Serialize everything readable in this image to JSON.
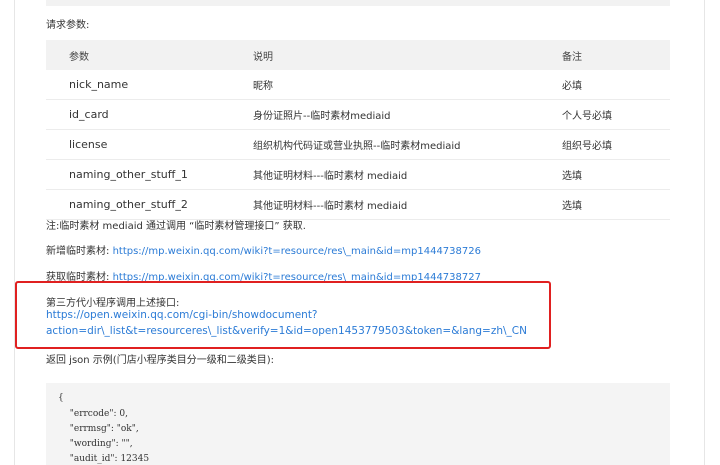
{
  "request_params_label": "请求参数:",
  "table": {
    "headers": [
      "参数",
      "说明",
      "备注"
    ],
    "rows": [
      {
        "param": "nick_name",
        "desc": "昵称",
        "note": "必填"
      },
      {
        "param": "id_card",
        "desc": "身份证照片--临时素材mediaid",
        "note": "个人号必填"
      },
      {
        "param": "license",
        "desc": "组织机构代码证或营业执照--临时素材mediaid",
        "note": "组织号必填"
      },
      {
        "param": "naming_other_stuff_1",
        "desc": "其他证明材料---临时素材 mediaid",
        "note": "选填"
      },
      {
        "param": "naming_other_stuff_2",
        "desc": "其他证明材料---临时素材 mediaid",
        "note": "选填"
      }
    ]
  },
  "note_line": "注:临时素材 mediaid 通过调用 “临时素材管理接口” 获取.",
  "new_material": {
    "label": "新增临时素材: ",
    "url": "https://mp.weixin.qq.com/wiki?t=resource/res\\_main&id=mp1444738726"
  },
  "get_material": {
    "label": "获取临时素材: ",
    "url": "https://mp.weixin.qq.com/wiki?t=resource/res\\_main&id=mp1444738727"
  },
  "third_party": {
    "title": "第三方代小程序调用上述接口:",
    "url_line1": "https://open.weixin.qq.com/cgi-bin/showdocument?",
    "url_line2": "action=dir\\_list&t=resourceres\\_list&verify=1&id=open1453779503&token=&lang=zh\\_CN"
  },
  "return_json_label": "返回 json 示例(门店小程序类目分一级和二级类目):",
  "code_lines": [
    "{",
    "  \"errcode\": 0,",
    "  \"errmsg\": \"ok\",",
    "  \"wording\": \"\",",
    "  \"audit_id\": 12345"
  ],
  "colors": {
    "link": "#2b7bd6",
    "highlight_box": "#e02020",
    "table_header_bg": "#f2f2f2"
  }
}
